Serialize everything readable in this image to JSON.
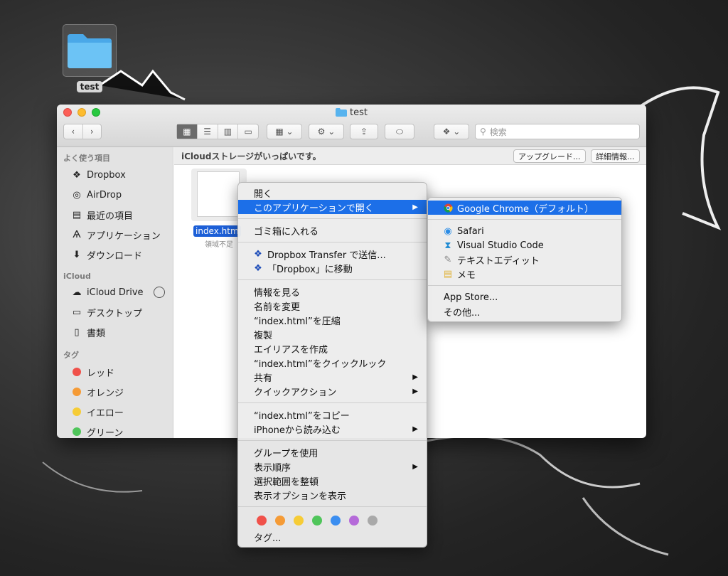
{
  "desktop": {
    "folder_label": "test"
  },
  "window": {
    "title": "test",
    "search_placeholder": "検索"
  },
  "sidebar": {
    "favorites_header": "よく使う項目",
    "favorites": [
      {
        "label": "Dropbox",
        "icon": "dropbox-icon"
      },
      {
        "label": "AirDrop",
        "icon": "airdrop-icon"
      },
      {
        "label": "最近の項目",
        "icon": "recent-icon"
      },
      {
        "label": "アプリケーション",
        "icon": "applications-icon"
      },
      {
        "label": "ダウンロード",
        "icon": "download-icon"
      }
    ],
    "icloud_header": "iCloud",
    "icloud": [
      {
        "label": "iCloud Drive",
        "icon": "cloud-icon"
      },
      {
        "label": "デスクトップ",
        "icon": "desktop-icon"
      },
      {
        "label": "書類",
        "icon": "documents-icon"
      }
    ],
    "tags_header": "タグ",
    "tags": [
      {
        "label": "レッド",
        "color": "#f0514a"
      },
      {
        "label": "オレンジ",
        "color": "#f59b36"
      },
      {
        "label": "イエロー",
        "color": "#f6cc36"
      },
      {
        "label": "グリーン",
        "color": "#4fc55a"
      }
    ]
  },
  "infobar": {
    "message": "iCloudストレージがいっぱいです。",
    "upgrade_label": "アップグレード...",
    "details_label": "詳細情報..."
  },
  "file": {
    "name": "index.htm",
    "status": "領域不足"
  },
  "context_menu": {
    "items": [
      "開く",
      "このアプリケーションで開く",
      "ゴミ箱に入れる",
      "Dropbox Transfer で送信...",
      "「Dropbox」に移動",
      "情報を見る",
      "名前を変更",
      "“index.html”を圧縮",
      "複製",
      "エイリアスを作成",
      "“index.html”をクイックルック",
      "共有",
      "クイックアクション",
      "“index.html”をコピー",
      "iPhoneから読み込む",
      "グループを使用",
      "表示順序",
      "選択範囲を整頓",
      "表示オプションを表示",
      "タグ..."
    ],
    "tag_colors": [
      "#f0514a",
      "#f59b36",
      "#f6cc36",
      "#4fc55a",
      "#3b8ef0",
      "#b56ad9",
      "#a9a9a9"
    ]
  },
  "submenu": {
    "items": [
      "Google Chrome（デフォルト）",
      "Safari",
      "Visual Studio Code",
      "テキストエディット",
      "メモ",
      "App Store...",
      "その他..."
    ]
  }
}
